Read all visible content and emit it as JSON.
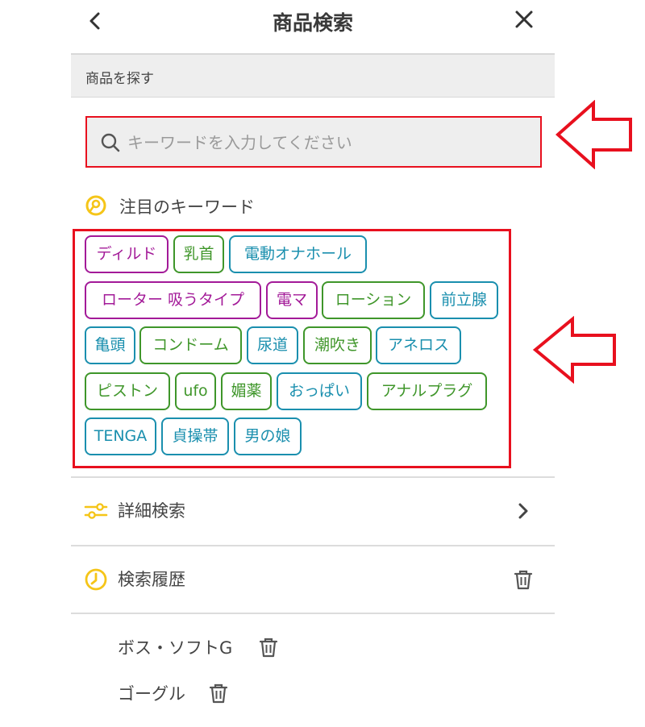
{
  "header": {
    "title": "商品検索",
    "back_icon": "chevron-left-icon",
    "close_icon": "close-icon"
  },
  "section": {
    "label": "商品を探す"
  },
  "search": {
    "placeholder": "キーワードを入力してください",
    "value": ""
  },
  "featured": {
    "title": "注目のキーワード",
    "tags": [
      {
        "label": "ディルド",
        "color": "#a31a98"
      },
      {
        "label": "乳首",
        "color": "#3f962a"
      },
      {
        "label": "電動オナホール",
        "color": "#1a8fae"
      },
      {
        "label": "ローター 吸うタイプ",
        "color": "#a31a98"
      },
      {
        "label": "電マ",
        "color": "#a31a98"
      },
      {
        "label": "ローション",
        "color": "#3f962a"
      },
      {
        "label": "前立腺",
        "color": "#1a8fae"
      },
      {
        "label": "亀頭",
        "color": "#1a8fae"
      },
      {
        "label": "コンドーム",
        "color": "#3f962a"
      },
      {
        "label": "尿道",
        "color": "#1a8fae"
      },
      {
        "label": "潮吹き",
        "color": "#3f962a"
      },
      {
        "label": "アネロス",
        "color": "#1a8fae"
      },
      {
        "label": "ピストン",
        "color": "#3f962a"
      },
      {
        "label": "ufo",
        "color": "#3f962a"
      },
      {
        "label": "媚薬",
        "color": "#3f962a"
      },
      {
        "label": "おっぱい",
        "color": "#1a8fae"
      },
      {
        "label": "アナルプラグ",
        "color": "#3f962a"
      },
      {
        "label": "TENGA",
        "color": "#1a8fae"
      },
      {
        "label": "貞操帯",
        "color": "#1a8fae"
      },
      {
        "label": "男の娘",
        "color": "#1a8fae"
      }
    ]
  },
  "detail_search": {
    "label": "詳細検索"
  },
  "history": {
    "title": "検索履歴",
    "items": [
      {
        "label": "ボス・ソフトG"
      },
      {
        "label": "ゴーグル"
      }
    ]
  },
  "colors": {
    "accent": "#f5c518",
    "highlight": "#e8101e"
  }
}
